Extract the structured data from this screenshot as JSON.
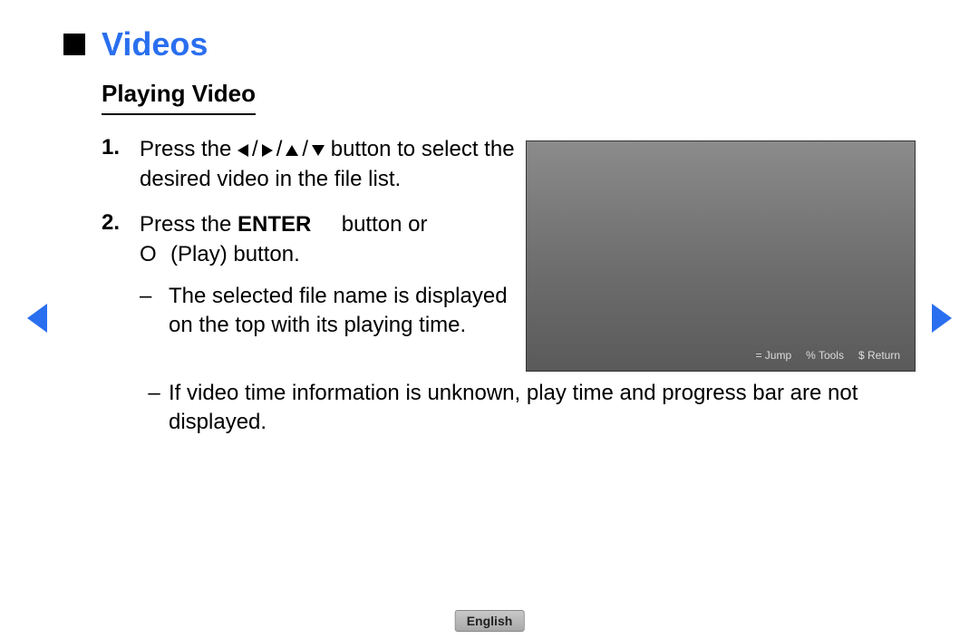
{
  "title": "Videos",
  "subtitle": "Playing Video",
  "steps": [
    {
      "num": "1.",
      "pre": "Press the ",
      "post": " button to select the desired video in the file list."
    },
    {
      "num": "2.",
      "text_pre": "Press the ",
      "enter_word": "ENTER",
      "text_mid": " button or ",
      "play_sym": "O",
      "text_post": " (Play) button."
    }
  ],
  "bullets_inner": [
    "The selected file name is displayed on the top with its playing time."
  ],
  "bullets_outer": [
    "If video time information is unknown, play time and progress bar are not displayed."
  ],
  "video_footer": {
    "jump": "= Jump",
    "tools": "% Tools",
    "return": "$ Return"
  },
  "language": "English"
}
